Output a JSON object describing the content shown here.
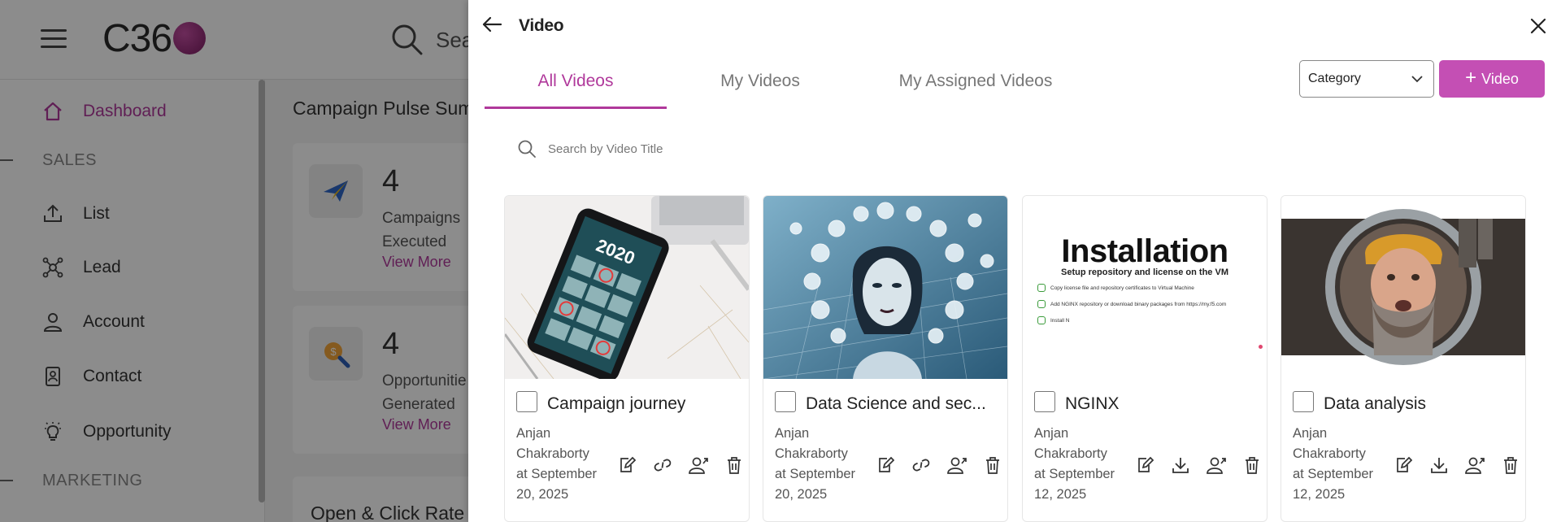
{
  "app": {
    "logo_text": "C36",
    "search_text": "Sea",
    "nav": [
      {
        "label": "Dashboard",
        "icon": "home-icon"
      },
      {
        "label": "List",
        "icon": "upload-icon"
      },
      {
        "label": "Lead",
        "icon": "network-icon"
      },
      {
        "label": "Account",
        "icon": "user-icon"
      },
      {
        "label": "Contact",
        "icon": "contact-icon"
      },
      {
        "label": "Opportunity",
        "icon": "lightbulb-icon"
      }
    ],
    "sections": {
      "sales": "SALES",
      "marketing": "MARKETING"
    },
    "main_title": "Campaign Pulse Sum",
    "stats": [
      {
        "number": "4",
        "label_line1": "Campaigns",
        "label_line2": "Executed",
        "link": "View More"
      },
      {
        "number": "4",
        "label_line1": "Opportunitie",
        "label_line2": "Generated",
        "link": "View More"
      }
    ],
    "chart_title": "Open & Click Rate"
  },
  "panel": {
    "title": "Video",
    "tabs": [
      "All Videos",
      "My Videos",
      "My Assigned Videos"
    ],
    "active_tab": 0,
    "category_label": "Category",
    "add_label": "Video",
    "search_placeholder": "Search by Video Title",
    "accent_color": "#b0399b",
    "videos": [
      {
        "title": "Campaign journey",
        "author_first": "Anjan",
        "author_last": "Chakraborty",
        "date_line1": "at September",
        "date_line2": "20, 2025",
        "actions": [
          "edit-icon",
          "link-icon",
          "assign-user-icon",
          "delete-icon"
        ]
      },
      {
        "title": "Data Science and sec...",
        "author_first": "Anjan",
        "author_last": "Chakraborty",
        "date_line1": "at September",
        "date_line2": "20, 2025",
        "actions": [
          "edit-icon",
          "link-icon",
          "assign-user-icon",
          "delete-icon"
        ]
      },
      {
        "title": "NGINX",
        "author_first": "Anjan",
        "author_last": "Chakraborty",
        "date_line1": "at September",
        "date_line2": "12, 2025",
        "actions": [
          "edit-icon",
          "download-icon",
          "assign-user-icon",
          "delete-icon"
        ]
      },
      {
        "title": "Data analysis",
        "author_first": "Anjan",
        "author_last": "Chakraborty",
        "date_line1": "at September",
        "date_line2": "12, 2025",
        "actions": [
          "edit-icon",
          "download-icon",
          "assign-user-icon",
          "delete-icon"
        ]
      }
    ],
    "thumb_texts": {
      "calendar_year": "2020",
      "install_title": "Installation",
      "install_subtitle": "Setup repository and license on the VM",
      "install_steps": [
        "Copy license file and repository certificates to Virtual Machine",
        "Add NGINX repository or download binary packages from https://my.f5.com",
        "Install N"
      ]
    }
  }
}
